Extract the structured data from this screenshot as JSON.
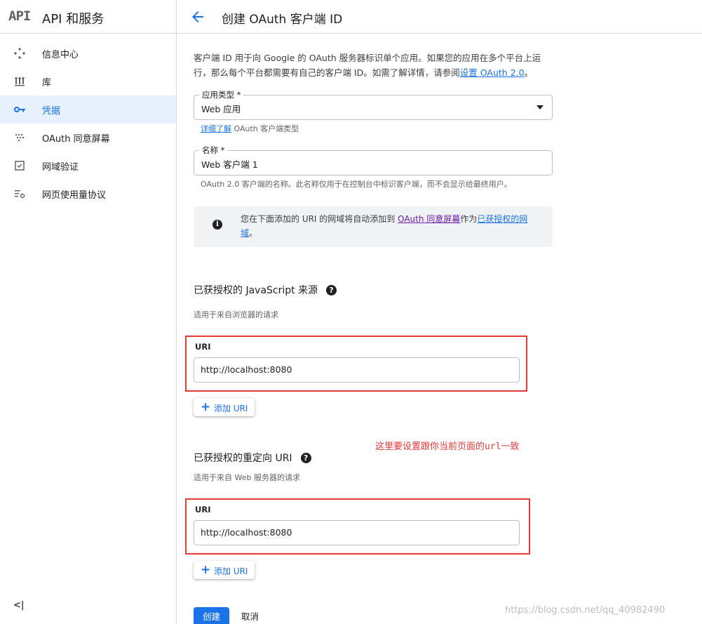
{
  "brand": {
    "logo": "API",
    "title": "API 和服务"
  },
  "sidebar": {
    "items": [
      {
        "label": "信息中心",
        "icon": "dashboard-icon",
        "active": false
      },
      {
        "label": "库",
        "icon": "library-icon",
        "active": false
      },
      {
        "label": "凭据",
        "icon": "key-icon",
        "active": true
      },
      {
        "label": "OAuth 同意屏幕",
        "icon": "consent-screen-icon",
        "active": false
      },
      {
        "label": "网域验证",
        "icon": "checkbox-icon",
        "active": false
      },
      {
        "label": "网页使用量协议",
        "icon": "settings-list-icon",
        "active": false
      }
    ],
    "collapse_label": "<|"
  },
  "header": {
    "title": "创建 OAuth 客户端 ID"
  },
  "intro": {
    "text": "客户端 ID 用于向 Google 的 OAuth 服务器标识单个应用。如果您的应用在多个平台上运行，那么每个平台都需要有自己的客户端 ID。如需了解详情，请参阅",
    "link": "设置 OAuth 2.0",
    "end": "。"
  },
  "app_type": {
    "label": "应用类型 *",
    "value": "Web 应用",
    "hint_link": "详细了解",
    "hint_text": " OAuth 客户端类型"
  },
  "name_field": {
    "label": "名称 *",
    "value": "Web 客户端 1",
    "hint": "OAuth 2.0 客户端的名称。此名称仅用于在控制台中标识客户端，而不会显示给最终用户。"
  },
  "info": {
    "text1": "您在下面添加的 URI 的网域将自动添加到 ",
    "link1": "OAuth 同意屏幕",
    "text2": "作为",
    "link2": "已获授权的网域",
    "end": "。"
  },
  "js_origins": {
    "title": "已获授权的 JavaScript 来源",
    "subtitle": "适用于来自浏览器的请求",
    "uri_label": "URI",
    "uri_value": "http://localhost:8080",
    "add_label": "添加 URI"
  },
  "annotation": "这里要设置跟你当前页面的url一致",
  "redirect_uris": {
    "title": "已获授权的重定向 URI",
    "subtitle": "适用于来自 Web 服务器的请求",
    "uri_label": "URI",
    "uri_value": "http://localhost:8080",
    "add_label": "添加 URI"
  },
  "actions": {
    "create": "创建",
    "cancel": "取消"
  },
  "watermark": "https://blog.csdn.net/qq_40982490",
  "colors": {
    "accent": "#1a73e8",
    "annotation": "#e53935",
    "active_bg": "#e8f0fe"
  }
}
